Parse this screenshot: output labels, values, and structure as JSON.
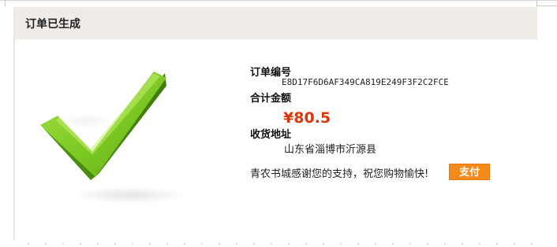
{
  "order": {
    "header_title": "订单已生成",
    "order_number_label": "订单编号",
    "order_number": "E8D17F6D6AF349CA819E249F3F2C2FCE",
    "total_label": "合计金额",
    "total_amount": "¥80.5",
    "address_label": "收货地址",
    "address": "山东省淄博市沂源县",
    "thanks_text": "青农书城感谢您的支持，祝您购物愉快!",
    "pay_button_label": "支付"
  },
  "colors": {
    "header_bg": "#efebe6",
    "price": "#d9360b",
    "pay_button": "#f38a1c",
    "check_green": "#7cc823"
  },
  "icons": {
    "success": "checkmark-icon"
  }
}
